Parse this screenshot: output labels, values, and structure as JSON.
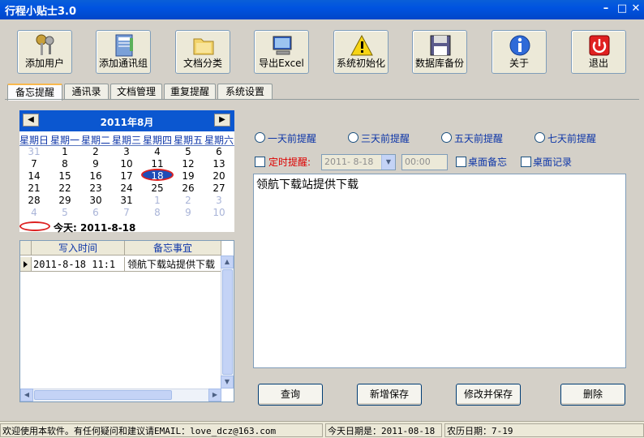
{
  "window": {
    "title": "行程小贴士3.0"
  },
  "toolbar": {
    "buttons": [
      {
        "label": "添加用户",
        "icon": "keys-icon"
      },
      {
        "label": "添加通讯组",
        "icon": "address-book-icon"
      },
      {
        "label": "文档分类",
        "icon": "folder-icon"
      },
      {
        "label": "导出Excel",
        "icon": "computer-icon"
      },
      {
        "label": "系统初始化",
        "icon": "warning-icon"
      },
      {
        "label": "数据库备份",
        "icon": "floppy-disk-icon"
      },
      {
        "label": "关于",
        "icon": "info-icon"
      },
      {
        "label": "退出",
        "icon": "power-icon"
      }
    ]
  },
  "tabs": [
    {
      "label": "备忘提醒",
      "active": true
    },
    {
      "label": "通讯录",
      "active": false
    },
    {
      "label": "文档管理",
      "active": false
    },
    {
      "label": "重复提醒",
      "active": false
    },
    {
      "label": "系统设置",
      "active": false
    }
  ],
  "calendar": {
    "month_title": "2011年8月",
    "weekdays": [
      "星期日",
      "星期一",
      "星期二",
      "星期三",
      "星期四",
      "星期五",
      "星期六"
    ],
    "weeks": [
      [
        "31",
        "1",
        "2",
        "3",
        "4",
        "5",
        "6"
      ],
      [
        "7",
        "8",
        "9",
        "10",
        "11",
        "12",
        "13"
      ],
      [
        "14",
        "15",
        "16",
        "17",
        "18",
        "19",
        "20"
      ],
      [
        "21",
        "22",
        "23",
        "24",
        "25",
        "26",
        "27"
      ],
      [
        "28",
        "29",
        "30",
        "31",
        "1",
        "2",
        "3"
      ],
      [
        "4",
        "5",
        "6",
        "7",
        "8",
        "9",
        "10"
      ]
    ],
    "today_label": "今天: 2011-8-18"
  },
  "memo_list": {
    "columns": [
      "写入时间",
      "备忘事宜"
    ],
    "rows": [
      [
        "2011-8-18 11:1",
        "领航下载站提供下载"
      ]
    ]
  },
  "reminder_options": {
    "radios": [
      "一天前提醒",
      "三天前提醒",
      "五天前提醒",
      "七天前提醒"
    ],
    "timed_label": "定时提醒:",
    "date_value": "2011- 8-18",
    "time_value": "00:00",
    "desktop_memo_label": "桌面备忘",
    "desktop_record_label": "桌面记录"
  },
  "memo_text": "领航下载站提供下载",
  "actions": {
    "query": "查询",
    "add_save": "新增保存",
    "modify_save": "修改并保存",
    "delete": "删除"
  },
  "status": {
    "welcome": "欢迎使用本软件。有任何疑问和建议请EMAIL：love_dcz@163.com",
    "today_date": "今天日期是：2011-08-18",
    "lunar_date": "农历日期：7-19"
  },
  "colors": {
    "titlebar": "#0053e0",
    "accent_blue": "#0e36a8",
    "alert_red": "#d00000"
  }
}
